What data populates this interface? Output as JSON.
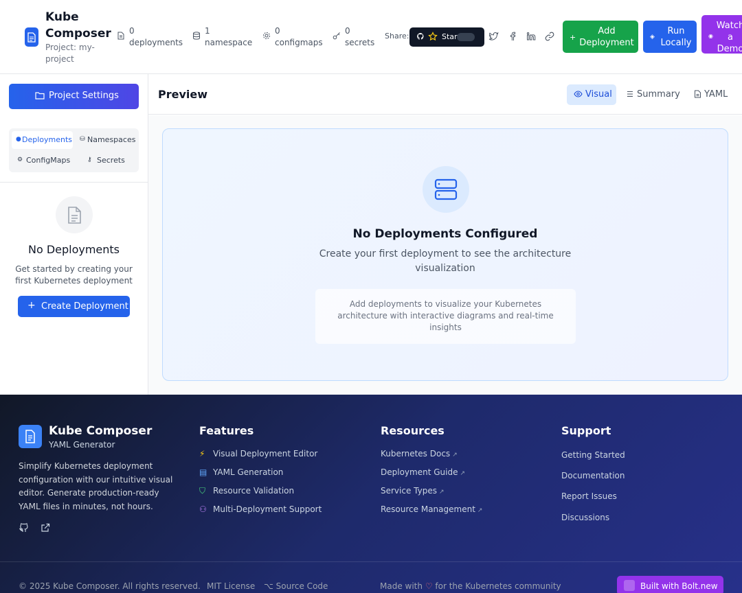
{
  "header": {
    "title": "Kube Composer",
    "project": "Project: my-project",
    "stats": [
      {
        "count": "0",
        "label": "deployments",
        "icon": "file-icon"
      },
      {
        "count": "1",
        "label": "namespace",
        "icon": "database-icon"
      },
      {
        "count": "0",
        "label": "configmaps",
        "icon": "gear-icon"
      },
      {
        "count": "0",
        "label": "secrets",
        "icon": "key-icon"
      }
    ],
    "share_label": "Share:",
    "star_label": "Star",
    "buttons": {
      "add": "Add Deployment",
      "run": "Run Locally",
      "demo": "Watch a Demo"
    }
  },
  "sidebar": {
    "project_settings": "Project Settings",
    "tabs": [
      {
        "label": "Deployments",
        "icon": "dot-icon"
      },
      {
        "label": "Namespaces",
        "icon": "database-icon"
      },
      {
        "label": "ConfigMaps",
        "icon": "gear-icon"
      },
      {
        "label": "Secrets",
        "icon": "key-icon"
      }
    ],
    "empty_title": "No Deployments",
    "empty_desc": "Get started by creating your first Kubernetes deployment",
    "create_button": "Create Deployment"
  },
  "main": {
    "title": "Preview",
    "view_tabs": [
      {
        "label": "Visual",
        "icon": "eye-icon"
      },
      {
        "label": "Summary",
        "icon": "list-icon"
      },
      {
        "label": "YAML",
        "icon": "file-icon"
      }
    ],
    "empty_title": "No Deployments Configured",
    "empty_desc": "Create your first deployment to see the architecture visualization",
    "hint": "Add deployments to visualize your Kubernetes architecture with interactive diagrams and real-time insights"
  },
  "footer": {
    "brand": "Kube Composer",
    "subtitle": "YAML Generator",
    "description": "Simplify Kubernetes deployment configuration with our intuitive visual editor. Generate production-ready YAML files in minutes, not hours.",
    "features_heading": "Features",
    "features": [
      "Visual Deployment Editor",
      "YAML Generation",
      "Resource Validation",
      "Multi-Deployment Support"
    ],
    "resources_heading": "Resources",
    "resources": [
      "Kubernetes Docs",
      "Deployment Guide",
      "Service Types",
      "Resource Management"
    ],
    "support_heading": "Support",
    "support": [
      "Getting Started",
      "Documentation",
      "Report Issues",
      "Discussions"
    ],
    "copyright": "© 2025 Kube Composer. All rights reserved.",
    "license": "MIT License",
    "source": "Source Code",
    "made_with": "Made with",
    "made_for": "for the Kubernetes community",
    "bolt": "Built with Bolt.new"
  },
  "colors": {
    "primary": "#2563eb",
    "success": "#16a34a",
    "purple": "#9333ea"
  }
}
